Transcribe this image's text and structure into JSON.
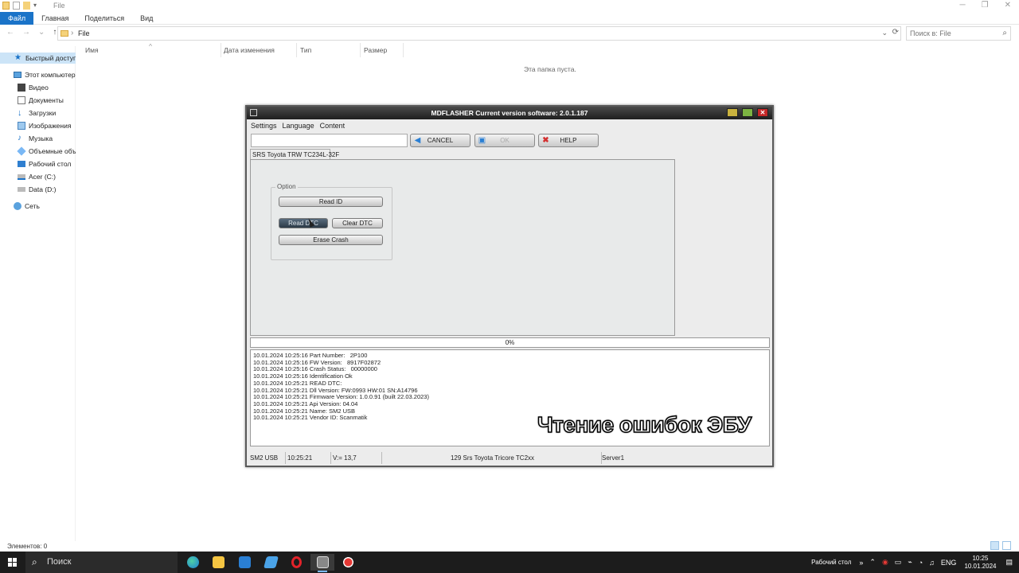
{
  "explorer": {
    "title": "File",
    "ribbon_tabs": [
      "Файл",
      "Главная",
      "Поделиться",
      "Вид"
    ],
    "address_path": "File",
    "search_placeholder": "Поиск в: File",
    "nav": {
      "quick_access": "Быстрый доступ",
      "this_pc": "Этот компьютер",
      "video": "Видео",
      "documents": "Документы",
      "downloads": "Загрузки",
      "pictures": "Изображения",
      "music": "Музыка",
      "objects3d": "Объемные объе",
      "desktop": "Рабочий стол",
      "drive_c": "Acer (C:)",
      "drive_d": "Data (D:)",
      "network": "Сеть"
    },
    "columns": [
      "Имя",
      "Дата изменения",
      "Тип",
      "Размер"
    ],
    "empty_message": "Эта папка пуста.",
    "status_count": "Элементов: 0"
  },
  "mdflasher": {
    "title": "MDFLASHER  Current version software: 2.0.1.187",
    "menu": [
      "Settings",
      "Language",
      "Content"
    ],
    "toolbar": {
      "cancel": "CANCEL",
      "ok": "OK",
      "help": "HELP"
    },
    "tab_label": "SRS Toyota TRW TC234L-32F",
    "option_legend": "Option",
    "buttons": {
      "read_id": "Read ID",
      "read_dtc": "Read DTC",
      "clear_dtc": "Clear DTC",
      "erase_crash": "Erase Crash"
    },
    "progress": "0%",
    "log": [
      "10.01.2024 10:25:16 Part Number:   2P100",
      "10.01.2024 10:25:16 FW Version:   8917F02872",
      "10.01.2024 10:25:16 Crash Status:   00000000",
      "10.01.2024 10:25:16 Identification Ok",
      "10.01.2024 10:25:21 READ DTC:",
      "10.01.2024 10:25:21 Dll Version: FW:0993 HW:01 SN:A14796",
      "10.01.2024 10:25:21 Firmware Version: 1.0.0.91 (built 22.03.2023)",
      "10.01.2024 10:25:21 Api Version: 04.04",
      "10.01.2024 10:25:21 Name: SM2 USB",
      "10.01.2024 10:25:21 Vendor ID: Scanmatik"
    ],
    "caption": "Чтение ошибок ЭБУ",
    "status": {
      "device": "SM2 USB",
      "time": "10:25:21",
      "voltage": "V:= 13,7",
      "module": "129 Srs Toyota Tricore TC2xx",
      "server": "Server1"
    }
  },
  "taskbar": {
    "search_text": "Поиск",
    "desktop_label": "Рабочий стол",
    "lang": "ENG",
    "time": "10:25",
    "date": "10.01.2024"
  },
  "colors": {
    "accent": "#1a73c8",
    "titlebar_dark": "#1f1f1f",
    "taskbar": "#1c1c1c"
  }
}
